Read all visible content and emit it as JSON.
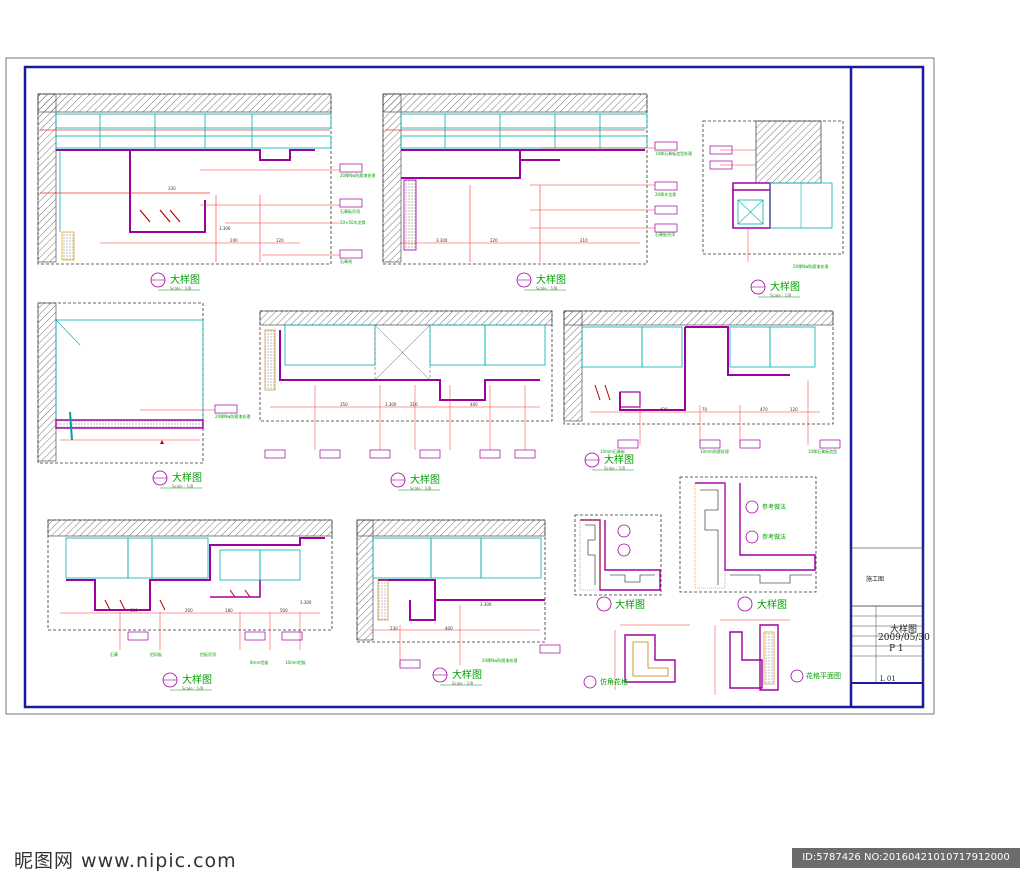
{
  "sheet": {
    "detail_title": "大样图",
    "scale_text": "Scale : 1/8",
    "notes": {
      "p1": [
        "20厚Nw防腐漆处理",
        "石膏板吊顶",
        "50×50木龙骨",
        "石膏线"
      ],
      "p2": [
        "10厚石膏板造型处理",
        "20厚木龙骨",
        "石膏板吊顶"
      ],
      "p3": [
        "20厚Nw防腐漆处理"
      ],
      "p4": [
        "20厚Nw防腐漆处理"
      ],
      "p6": [
        "10mm石膏板",
        "10mm防腐处理",
        "10厚石膏板造型"
      ],
      "p7": [
        "石膏",
        "铝扣板",
        "铝板吊顶",
        "8mm铝板",
        "10mm铝板"
      ],
      "p8": [
        "20厚Nw防腐漆处理"
      ],
      "p9": [
        "参考做法",
        "参考做法"
      ],
      "p10_label": "仿角花格",
      "p11_label": "花格平面图"
    },
    "dims": {
      "p1": [
        "330",
        "240",
        "120",
        "3.300"
      ],
      "p2": [
        "220",
        "210",
        "3.300"
      ],
      "p5": [
        "350",
        "310",
        "400",
        "3.300"
      ],
      "p6": [
        "420",
        "70",
        "470",
        "120"
      ],
      "p7": [
        "600",
        "200",
        "180",
        "500",
        "3.300"
      ],
      "p8": [
        "230",
        "400",
        "3.300"
      ]
    }
  },
  "title_block": {
    "drawing_name": "大样图",
    "sheet_name": "施工图",
    "date": "2009/05/30",
    "page": "P 1",
    "code": "L 01"
  },
  "watermark": {
    "left": "昵图网 www.nipic.com",
    "right": "ID:5787426 NO:20160421010717912000"
  }
}
